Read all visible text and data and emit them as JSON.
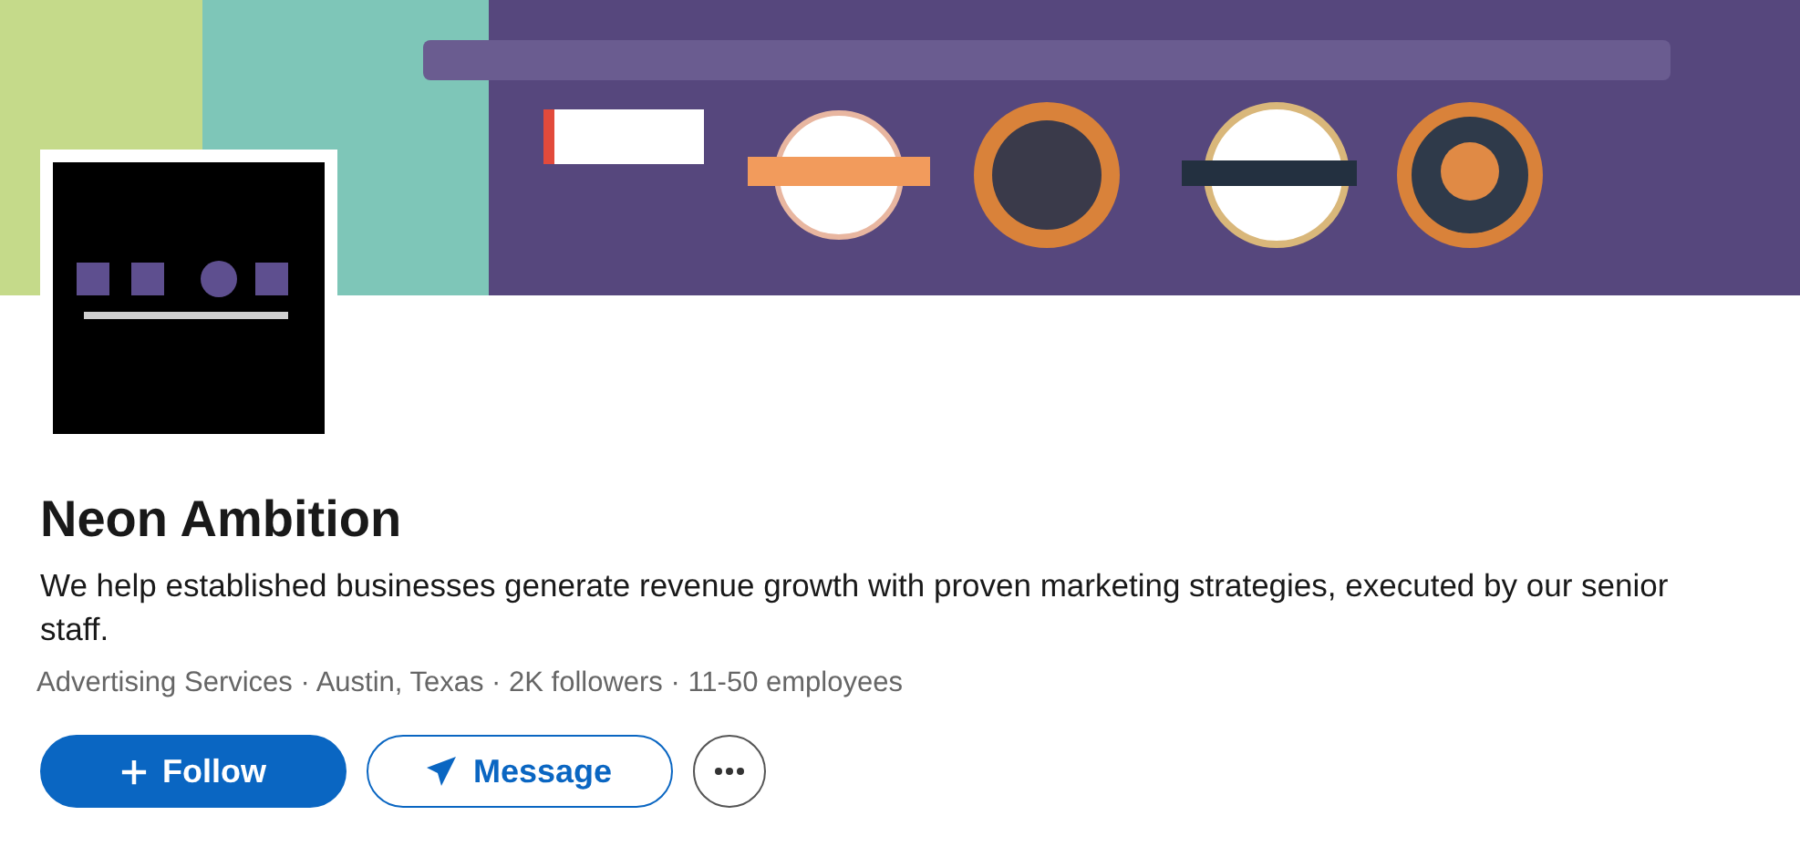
{
  "company": {
    "name": "Neon Ambition",
    "tagline": "We help established businesses generate revenue growth with proven marketing strategies, executed by our senior staff.",
    "meta": "Advertising Services · Austin, Texas · 2K followers · 11-50 employees"
  },
  "actions": [
    {
      "kind": "primary",
      "label": "Follow"
    },
    {
      "kind": "secondary",
      "label": "Message"
    },
    {
      "kind": "more"
    }
  ]
}
